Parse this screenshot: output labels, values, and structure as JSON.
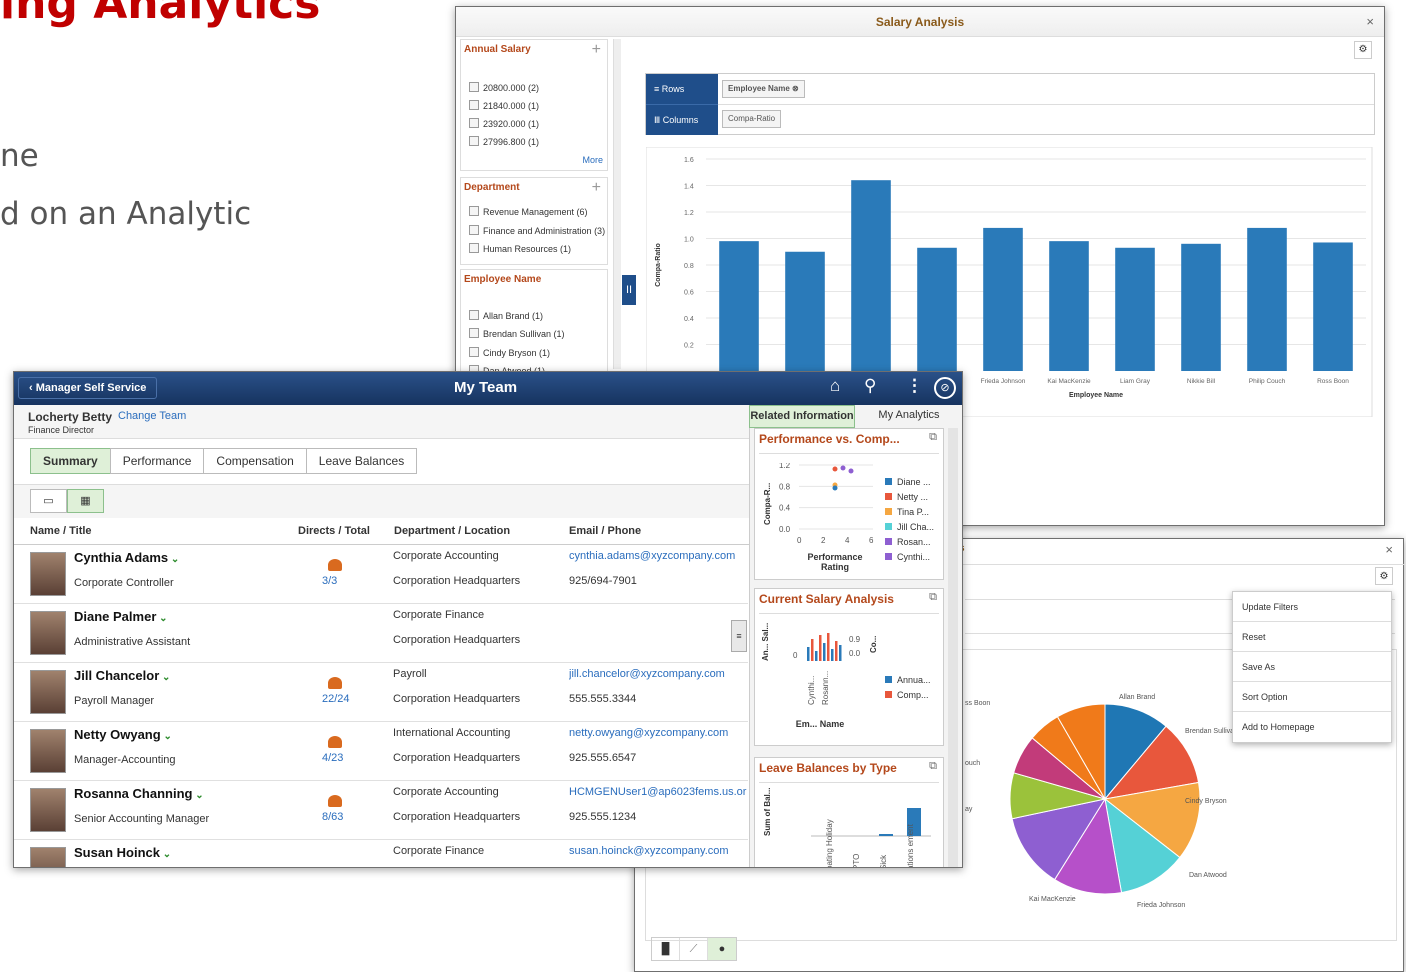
{
  "slide": {
    "title": "ing Analytics",
    "bullet1": "ne",
    "bullet2": "d on an Analytic"
  },
  "salary_window": {
    "title": "Salary Analysis",
    "close": "×",
    "facets": [
      {
        "name": "Annual Salary",
        "items": [
          "20800.000 (2)",
          "21840.000 (1)",
          "23920.000 (1)",
          "27996.800 (1)"
        ],
        "more": "More"
      },
      {
        "name": "Department",
        "items": [
          "Revenue Management (6)",
          "Finance and Administration (3)",
          "Human Resources (1)"
        ]
      },
      {
        "name": "Employee Name",
        "items": [
          "Allan Brand (1)",
          "Brendan Sullivan (1)",
          "Cindy Bryson (1)",
          "Dan Atwood (1)"
        ]
      }
    ],
    "rows_label": "Rows",
    "columns_label": "Columns",
    "rows_chip": "Employee Name",
    "columns_chip": "Compa-Ratio"
  },
  "chart_data": {
    "type": "bar",
    "categories": [
      "",
      "",
      "",
      "",
      "Frieda Johnson",
      "Kai MacKenzie",
      "Liam Gray",
      "Nikkie Bill",
      "Philip Couch",
      "Ross Boon"
    ],
    "values": [
      0.98,
      0.9,
      1.44,
      0.93,
      1.08,
      0.98,
      0.93,
      0.96,
      1.08,
      0.97
    ],
    "xlabel": "Employee Name",
    "ylabel": "Compa-Ratio",
    "ylim": [
      0,
      1.6
    ],
    "yticks": [
      "0.2",
      "0.4",
      "0.6",
      "0.8",
      "1.0",
      "1.2",
      "1.4",
      "1.6"
    ],
    "color": "#2a7ab9",
    "grid": true
  },
  "pie_window": {
    "title_fragment": "s",
    "close": "×",
    "menu": [
      "Update Filters",
      "Reset",
      "Save As",
      "Sort Option",
      "Add to Homepage"
    ],
    "pie_labels": [
      "Allan Brand",
      "Brendan Sullivan",
      "Cindy Bryson",
      "Dan Atwood",
      "Frieda Johnson",
      "Kai MacKenzie",
      "ss Boon",
      "ouch",
      "ay"
    ],
    "pie_colors": [
      "#1f77b4",
      "#e8573c",
      "#f5a742",
      "#55d1d6",
      "#b650c9",
      "#8e5fd1",
      "#9bc23b",
      "#c23b7a",
      "#f07a1a"
    ]
  },
  "myteam": {
    "back": "Manager Self Service",
    "title": "My Team",
    "manager_name": "Locherty Betty",
    "change_team": "Change Team",
    "manager_title": "Finance Director",
    "tabs": [
      "Summary",
      "Performance",
      "Compensation",
      "Leave Balances"
    ],
    "columns": [
      "Name / Title",
      "Directs / Total",
      "Department / Location",
      "Email / Phone"
    ],
    "rows": [
      {
        "name": "Cynthia Adams",
        "title": "Corporate Controller",
        "count": "3/3",
        "dept": "Corporate Accounting",
        "loc": "Corporation Headquarters",
        "email": "cynthia.adams@xyzcompany.com",
        "phone": "925/694-7901"
      },
      {
        "name": "Diane Palmer",
        "title": "Administrative Assistant",
        "count": "",
        "dept": "Corporate Finance",
        "loc": "Corporation Headquarters",
        "email": "",
        "phone": ""
      },
      {
        "name": "Jill Chancelor",
        "title": "Payroll Manager",
        "count": "22/24",
        "dept": "Payroll",
        "loc": "Corporation Headquarters",
        "email": "jill.chancelor@xyzcompany.com",
        "phone": "555.555.3344"
      },
      {
        "name": "Netty Owyang",
        "title": "Manager-Accounting",
        "count": "4/23",
        "dept": "International Accounting",
        "loc": "Corporation Headquarters",
        "email": "netty.owyang@xyzcompany.com",
        "phone": "925.555.6547"
      },
      {
        "name": "Rosanna Channing",
        "title": "Senior Accounting Manager",
        "count": "8/63",
        "dept": "Corporate Accounting",
        "loc": "Corporation Headquarters",
        "email": "HCMGENUser1@ap6023fems.us.or",
        "phone": "925.555.1234"
      },
      {
        "name": "Susan Hoinck",
        "title": "",
        "count": "",
        "dept": "Corporate Finance",
        "loc": "",
        "email": "susan.hoinck@xyzcompany.com",
        "phone": ""
      }
    ],
    "panel_tabs": [
      "Related Information",
      "My Analytics"
    ],
    "tiles": [
      {
        "title": "Performance vs. Comp...",
        "y_label": "Compa-R...",
        "x_label": "Performance Rating",
        "yticks": [
          "1.2",
          "0.8",
          "0.4",
          "0.0"
        ],
        "xticks": [
          "0",
          "2",
          "4",
          "6"
        ],
        "legend": [
          {
            "name": "Diane ...",
            "color": "#2a7ab9"
          },
          {
            "name": "Netty ...",
            "color": "#e8573c"
          },
          {
            "name": "Tina P...",
            "color": "#f5a742"
          },
          {
            "name": "Jill Cha...",
            "color": "#55d1d6"
          },
          {
            "name": "Rosan...",
            "color": "#8e5fd1"
          },
          {
            "name": "Cynthi...",
            "color": "#8e5fd1"
          }
        ]
      },
      {
        "title": "Current Salary Analysis",
        "y_label": "An... Sal...",
        "y2_label": "Co...",
        "x_label": "Em... Name",
        "yticks": [
          "0"
        ],
        "y2ticks": [
          "0.9",
          "0.0"
        ],
        "xticks": [
          "Cynthi...",
          "Rosann..."
        ],
        "legend": [
          {
            "name": "Annua...",
            "color": "#2a7ab9"
          },
          {
            "name": "Comp...",
            "color": "#e8573c"
          }
        ]
      },
      {
        "title": "Leave Balances by Type",
        "y_label": "Sum of Bal...",
        "xticks": [
          "oating Holiday",
          "PTO",
          "Sick",
          "ations ement"
        ]
      }
    ]
  }
}
